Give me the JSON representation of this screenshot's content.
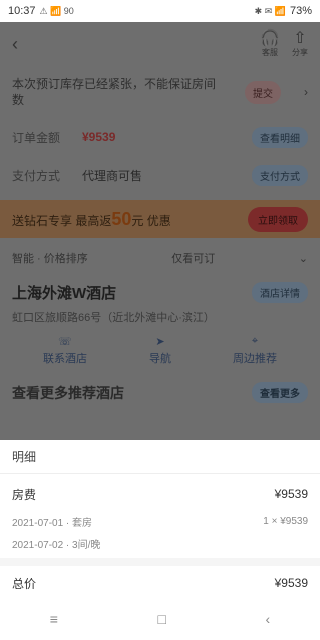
{
  "status": {
    "time": "10:37",
    "left_icons": "⚠ 📶 90",
    "right_icons": "✱ ✉ 📶",
    "battery": "73%"
  },
  "header": {
    "back_glyph": "‹",
    "service_glyph": "🎧",
    "service_label": "客服",
    "share_glyph": "⇧",
    "share_label": "分享"
  },
  "notice": {
    "text": "本次预订库存已经紧张，不能保证房间数",
    "button": "提交",
    "chevron": "›"
  },
  "rows": [
    {
      "label": "订单金额",
      "value": "¥9539",
      "action": "查看明细"
    },
    {
      "label": "支付方式",
      "value": "代理商可售",
      "action": "支付方式"
    }
  ],
  "promo": {
    "text_prefix": "送钻石专享 最高返",
    "big": "50",
    "text_suffix": "元 优惠",
    "button": "立即领取"
  },
  "filters": {
    "left": "智能 · 价格排序",
    "mid": "仅看可订",
    "chevron": "⌄"
  },
  "hotel": {
    "name": "上海外滩W酒店",
    "pill": "酒店详情",
    "address": "虹口区旅顺路66号（近北外滩中心·滨江）",
    "actions": [
      {
        "icon": "☏",
        "label": "联系酒店"
      },
      {
        "icon": "➤",
        "label": "导航"
      },
      {
        "icon": "⌖",
        "label": "周边推荐"
      }
    ]
  },
  "hotel2": {
    "name": "查看更多推荐酒店",
    "pill": "查看更多"
  },
  "sheet": {
    "title": "明细",
    "rows": [
      {
        "label": "房费",
        "value": "¥9539"
      },
      {
        "label": "2021-07-01 · 套房",
        "value": "1 × ¥9539"
      },
      {
        "label": "2021-07-02 · 3间/晚",
        "value": ""
      }
    ],
    "total_label": "总价",
    "total_value": "¥9539"
  },
  "nav": {
    "menu": "≡",
    "home": "□",
    "back": "‹"
  }
}
